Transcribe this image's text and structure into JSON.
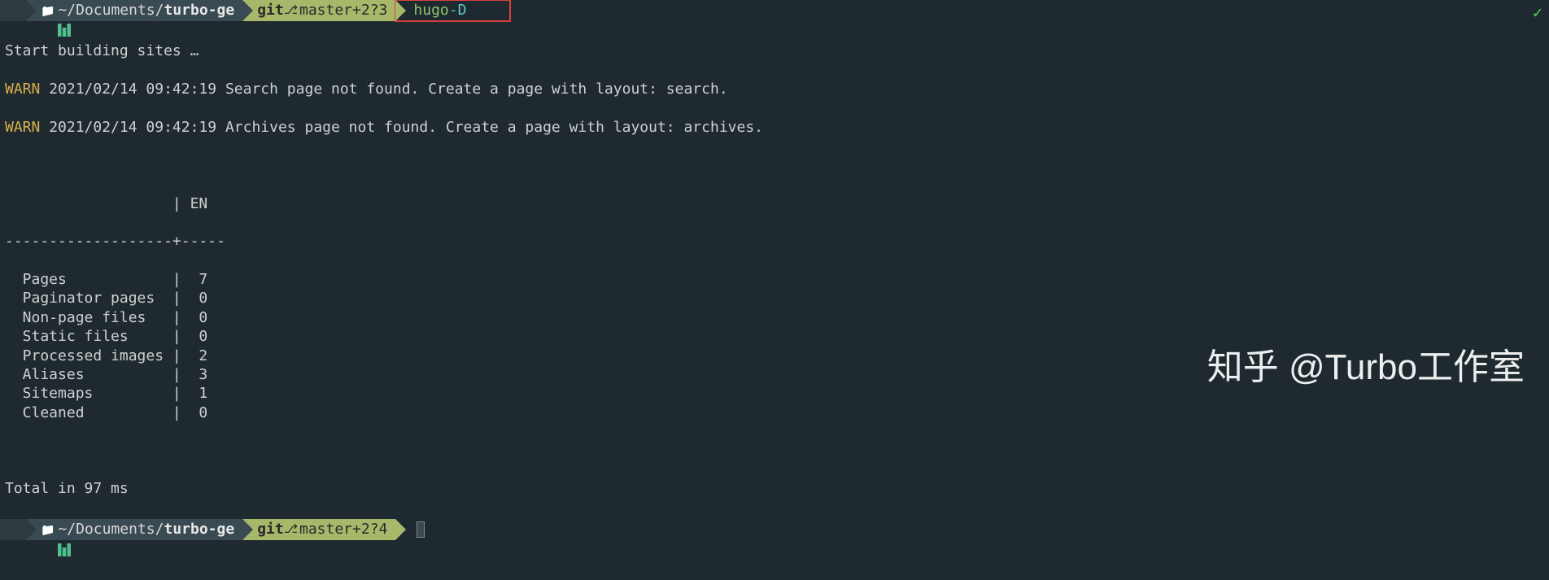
{
  "prompt1": {
    "path_prefix": "~/Documents/",
    "path_bold": "turbo-ge",
    "git_label": "git",
    "branch_icon": "⎇",
    "branch": "master",
    "ahead": "+2",
    "untracked": "?3",
    "command_name": "hugo",
    "command_flag": "-D"
  },
  "output": {
    "line_start": "Start building sites …",
    "warn_label": "WARN",
    "warn1_ts": "2021/02/14 09:42:19",
    "warn1_msg": "Search page not found. Create a page with layout: search.",
    "warn2_ts": "2021/02/14 09:42:19",
    "warn2_msg": "Archives page not found. Create a page with layout: archives.",
    "table_header": "                   | EN  ",
    "table_sep": "-------------------+-----",
    "rows": [
      {
        "label": "  Pages            |  7  "
      },
      {
        "label": "  Paginator pages  |  0  "
      },
      {
        "label": "  Non-page files   |  0  "
      },
      {
        "label": "  Static files     |  0  "
      },
      {
        "label": "  Processed images |  2  "
      },
      {
        "label": "  Aliases          |  3  "
      },
      {
        "label": "  Sitemaps         |  1  "
      },
      {
        "label": "  Cleaned          |  0  "
      }
    ],
    "total": "Total in 97 ms"
  },
  "prompt2": {
    "path_prefix": "~/Documents/",
    "path_bold": "turbo-ge",
    "git_label": "git",
    "branch_icon": "⎇",
    "branch": "master",
    "ahead": "+2",
    "untracked": "?4"
  },
  "check": "✓",
  "watermark": "知乎 @Turbo工作室"
}
